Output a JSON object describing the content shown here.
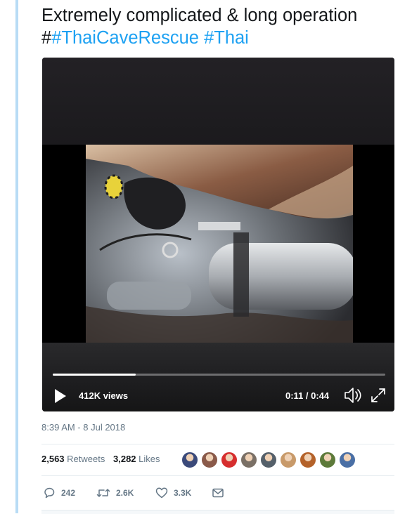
{
  "tweet": {
    "text_line1": "Extremely complicated & long operation",
    "hash_prefix": "#",
    "hashtag1": "#ThaiCaveRescue",
    "hashtag2": "#Thai"
  },
  "video": {
    "views": "412K views",
    "time": "0:11 / 0:44",
    "progress_fraction": 0.25
  },
  "timestamp": "8:39 AM - 8 Jul 2018",
  "stats": {
    "retweets_count": "2,563",
    "retweets_label": "Retweets",
    "likes_count": "3,282",
    "likes_label": "Likes"
  },
  "avatars": [
    {
      "name": "avatar-1",
      "color": "#3b4a7a"
    },
    {
      "name": "avatar-2",
      "color": "#8a5a4a"
    },
    {
      "name": "avatar-3",
      "color": "#d62e2e"
    },
    {
      "name": "avatar-4",
      "color": "#7a7066"
    },
    {
      "name": "avatar-5",
      "color": "#55606a"
    },
    {
      "name": "avatar-6",
      "color": "#c89a6a"
    },
    {
      "name": "avatar-7",
      "color": "#b4622a"
    },
    {
      "name": "avatar-8",
      "color": "#5d7a3a"
    },
    {
      "name": "avatar-9",
      "color": "#4a6fa5"
    }
  ],
  "actions": {
    "replies": "242",
    "retweets": "2.6K",
    "likes": "3.3K"
  },
  "icons": {
    "play": "play-icon",
    "volume": "volume-icon",
    "fullscreen": "fullscreen-icon",
    "reply": "reply-icon",
    "retweet": "retweet-icon",
    "like": "heart-icon",
    "message": "envelope-icon"
  }
}
